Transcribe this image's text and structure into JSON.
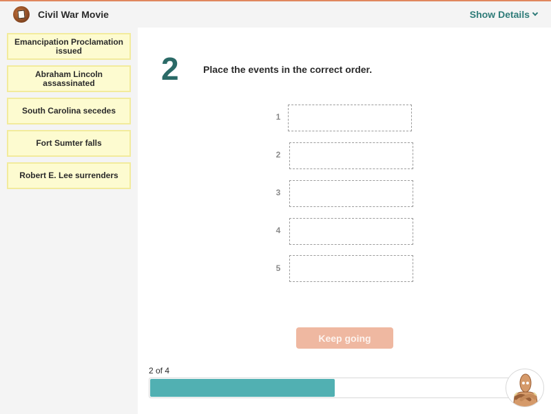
{
  "header": {
    "logo_icon": "civil-war-movie-logo",
    "title": "Civil War Movie",
    "show_details_label": "Show Details",
    "show_details_icon": "chevron-down-icon"
  },
  "sidebar": {
    "cards": [
      {
        "label": "Emancipation Proclamation issued"
      },
      {
        "label": "Abraham Lincoln assassinated"
      },
      {
        "label": "South Carolina secedes"
      },
      {
        "label": "Fort Sumter falls"
      },
      {
        "label": "Robert E. Lee surrenders"
      }
    ]
  },
  "question": {
    "number": "2",
    "prompt": "Place the events in the correct order.",
    "slots": [
      {
        "label": "1",
        "value": ""
      },
      {
        "label": "2",
        "value": ""
      },
      {
        "label": "3",
        "value": ""
      },
      {
        "label": "4",
        "value": ""
      },
      {
        "label": "5",
        "value": ""
      }
    ]
  },
  "actions": {
    "keep_going_label": "Keep going",
    "keep_going_color": "#efb8a1"
  },
  "progress": {
    "label": "2 of 4",
    "current": 2,
    "total": 4,
    "fraction": 0.5,
    "fill_color": "#51b0b2"
  },
  "mascot": {
    "icon": "moby-robot-mascot"
  },
  "colors": {
    "accent_orange": "#e0875e",
    "teal_dark": "#2b6a67",
    "teal_link": "#2e7b78",
    "card_bg": "#fdfbd0",
    "card_border": "#f2eb9c"
  }
}
